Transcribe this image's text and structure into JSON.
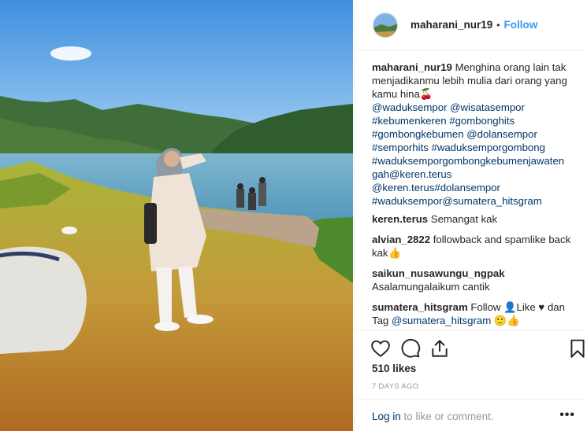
{
  "post": {
    "username": "maharani_nur19",
    "separator": "•",
    "follow_label": "Follow",
    "likes": "510 likes",
    "date": "7 DAYS AGO"
  },
  "caption": {
    "username": "maharani_nur19",
    "text": "Menghina orang lain tak menjadikanmu lebih mulia dari orang yang kamu hina",
    "emoji": "🍒",
    "tags_line1": "@waduksempor @wisatasempor",
    "tags_line2": "#kebumenkeren #gombonghits",
    "tags_line3": "#gombongkebumen @dolansempor",
    "tags_line4": "#semporhits #waduksemporgombong",
    "tags_line5": "#waduksemporgombongkebumenjawaten",
    "tags_line6": "gah@keren.terus",
    "tags_line7": "@keren.terus#dolansempor",
    "tags_line8": "#waduksempor@sumatera_hitsgram"
  },
  "comments": [
    {
      "username": "keren.terus",
      "text": "Semangat kak"
    },
    {
      "username": "alvian_2822",
      "text": "followback and spamlike back kak",
      "emoji": "👍"
    },
    {
      "username": "saikun_nusawungu_ngpak",
      "text": "Asalamungalaikum cantik"
    },
    {
      "username": "sumatera_hitsgram",
      "text_a": "Follow",
      "emoji_a": "👤",
      "text_b": "Like",
      "emoji_b": "♥",
      "text_c": "dan Tag",
      "mention": "@sumatera_hitsgram",
      "emoji_c": "🙂👍"
    }
  ],
  "footer": {
    "login_link": "Log in",
    "login_rest": " to like or comment.",
    "more": "•••"
  },
  "icons": {
    "like": "heart-icon",
    "comment": "comment-icon",
    "share": "share-icon",
    "save": "bookmark-icon"
  },
  "colors": {
    "link_blue": "#3897f0",
    "text_dark": "#262626",
    "muted": "#999999",
    "hashtag": "#003569"
  }
}
